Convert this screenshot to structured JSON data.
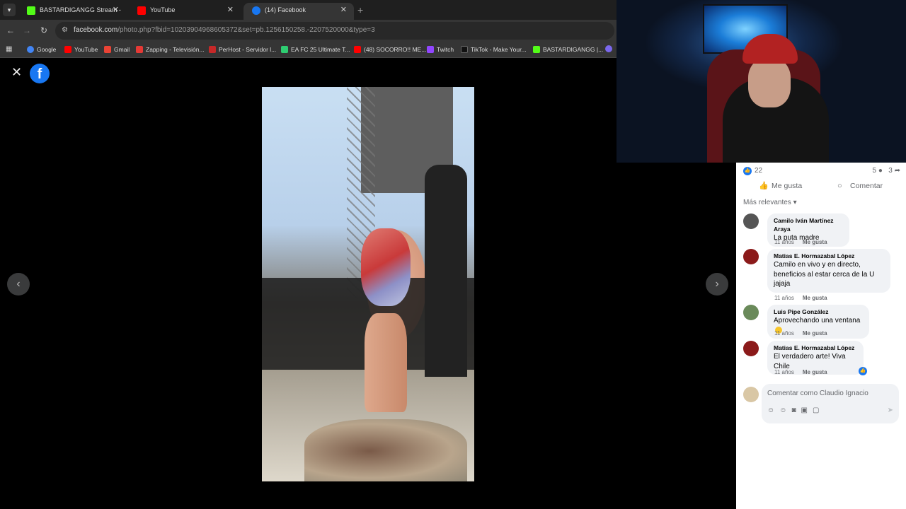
{
  "browser": {
    "tabs": [
      {
        "title": "BASTARDIGANGG Stream - Wa",
        "favicon_color": "#53fc18",
        "active": false
      },
      {
        "title": "YouTube",
        "favicon_color": "#ff0000",
        "active": false
      },
      {
        "title": "(14) Facebook",
        "favicon_color": "#1877f2",
        "active": true
      }
    ],
    "url_host": "facebook.com",
    "url_rest": "/photo.php?fbid=10203904968605372&set=pb.1256150258.-2207520000&type=3",
    "bookmarks": [
      {
        "label": "Google",
        "color": "#4285f4"
      },
      {
        "label": "YouTube",
        "color": "#ff0000"
      },
      {
        "label": "Gmail",
        "color": "#ea4335"
      },
      {
        "label": "Zapping - Televisión...",
        "color": "#e53935"
      },
      {
        "label": "PerHost - Servidor l...",
        "color": "#c62828"
      },
      {
        "label": "EA FC 25 Ultimate T...",
        "color": "#2ecc71"
      },
      {
        "label": "(48) SOCORRO!! ME...",
        "color": "#ff0000"
      },
      {
        "label": "Twitch",
        "color": "#9146ff"
      },
      {
        "label": "TikTok - Make Your...",
        "color": "#111111"
      },
      {
        "label": "BASTARDIGANGG |...",
        "color": "#53fc18"
      }
    ]
  },
  "viewer": {
    "close_icon": "close-icon",
    "logo_letter": "f",
    "prev_glyph": "‹",
    "next_glyph": "›"
  },
  "panel": {
    "reaction_count": "22",
    "comment_count": "5",
    "share_count": "3",
    "like_label": "Me gusta",
    "comment_label": "Comentar",
    "sort_label": "Más relevantes",
    "comments": [
      {
        "name": "Camilo Iván Martínez Araya",
        "text": "La puta madre",
        "age": "11 años",
        "like": "Me gusta",
        "avatar_color": "#555555"
      },
      {
        "name": "Matias E. Hormazabal López",
        "text": "Camilo en vivo y en directo, beneficios al estar cerca de la U jajaja",
        "age": "11 años",
        "like": "Me gusta",
        "avatar_color": "#8b1a1a"
      },
      {
        "name": "Luis Pipe González",
        "text": "Aprovechando una ventana",
        "age": "11 años",
        "like": "Me gusta",
        "avatar_color": "#6a8a5a"
      },
      {
        "name": "Matias E. Hormazabal López",
        "text": "El verdadero arte! Viva Chile",
        "age": "11 años",
        "like": "Me gusta",
        "avatar_color": "#8b1a1a"
      }
    ],
    "composer_placeholder": "Comentar como Claudio Ignacio"
  }
}
